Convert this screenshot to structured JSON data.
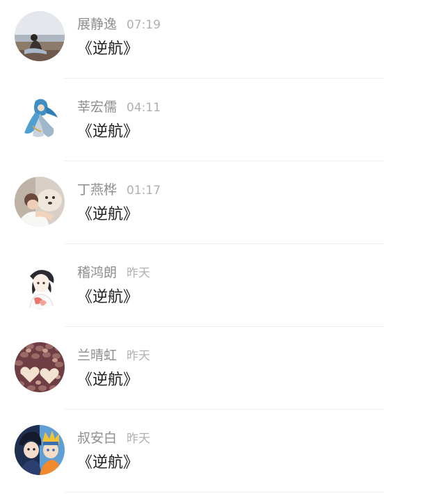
{
  "comments": [
    {
      "author": "展静逸",
      "time": "07:19",
      "content": "《逆航》",
      "avatar_icon": "avatar-photo-person-by-sea"
    },
    {
      "author": "莘宏儒",
      "time": "04:11",
      "content": "《逆航》",
      "avatar_icon": "avatar-anime-blue-hair-girl"
    },
    {
      "author": "丁燕桦",
      "time": "01:17",
      "content": "《逆航》",
      "avatar_icon": "avatar-photo-child-with-dog"
    },
    {
      "author": "稽鸿朗",
      "time": "昨天",
      "content": "《逆航》",
      "avatar_icon": "avatar-anime-girl-sketch"
    },
    {
      "author": "兰晴虹",
      "time": "昨天",
      "content": "《逆航》",
      "avatar_icon": "avatar-hearts-on-beans"
    },
    {
      "author": "叔安白",
      "time": "昨天",
      "content": "《逆航》",
      "avatar_icon": "avatar-anime-two-boys"
    }
  ],
  "colors": {
    "author": "#8e8e8e",
    "time": "#b0b0b0",
    "content": "#1f1f1f",
    "divider": "#efefef"
  }
}
